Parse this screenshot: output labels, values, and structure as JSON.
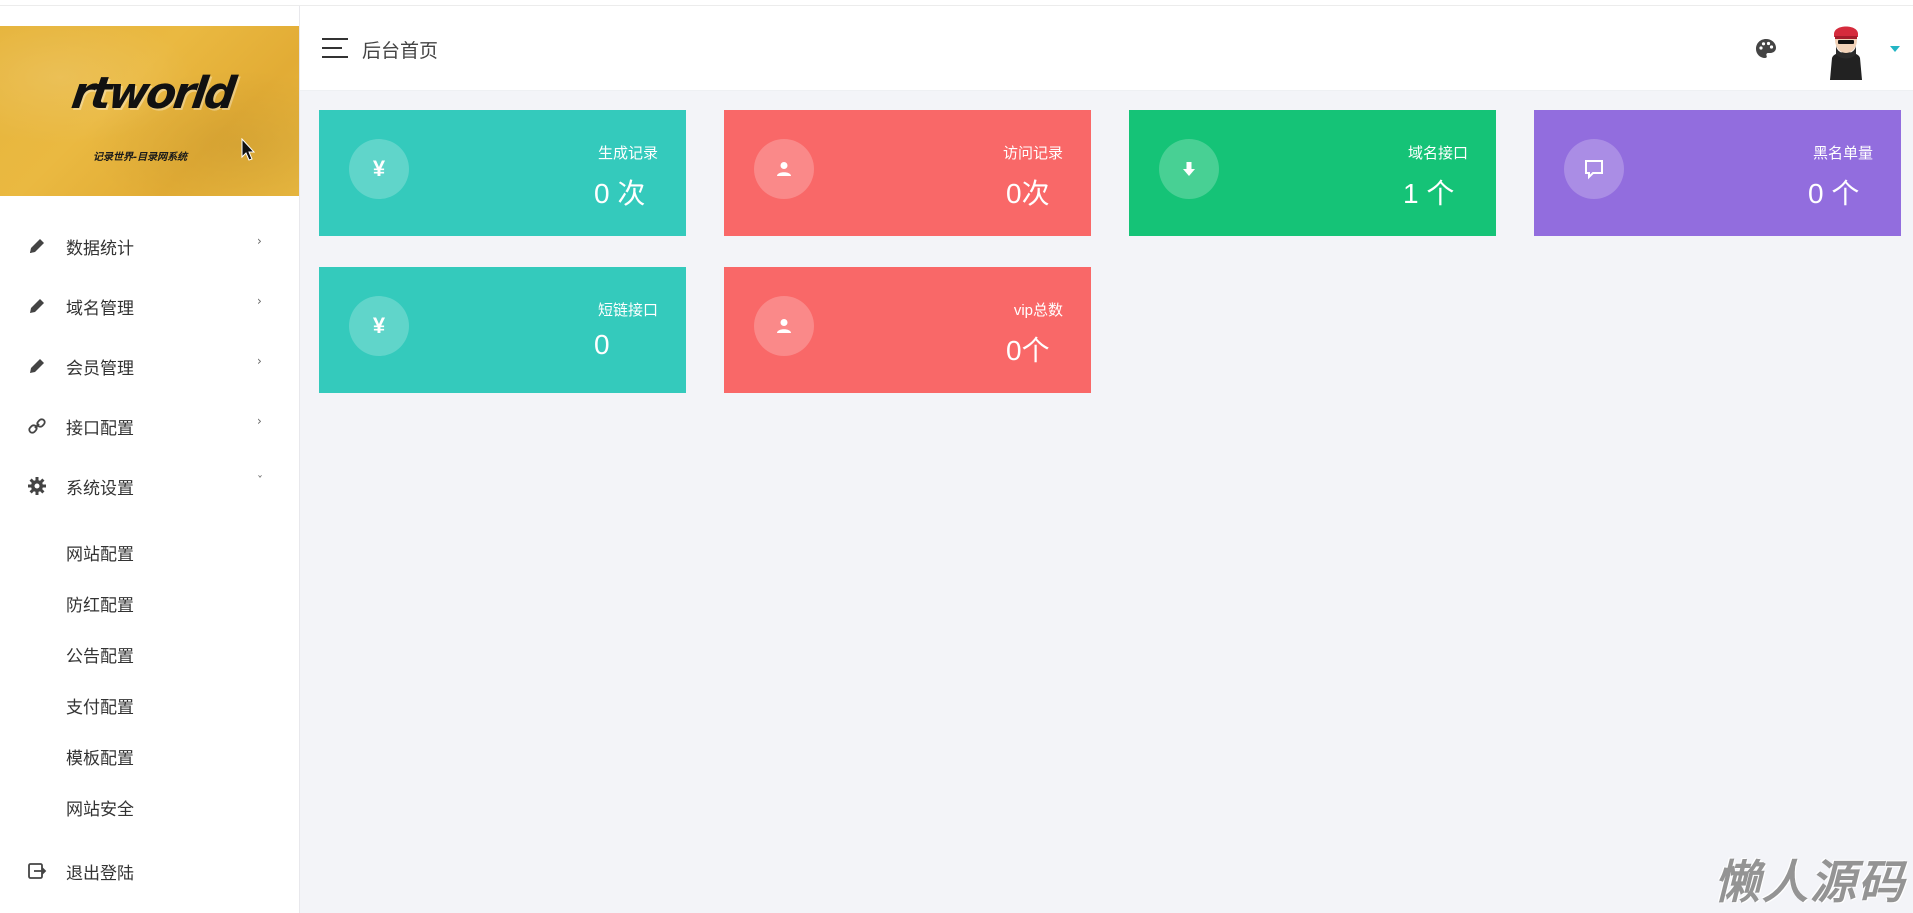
{
  "logo": {
    "wordmark": "rtworld",
    "tagline": "记录世界-目录网系统"
  },
  "header": {
    "title": "后台首页",
    "caret_color": "#23b5c4"
  },
  "sidebar": {
    "items": [
      {
        "label": "数据统计",
        "icon": "pencil-icon",
        "arrow": "›"
      },
      {
        "label": "域名管理",
        "icon": "pencil-icon",
        "arrow": "›"
      },
      {
        "label": "会员管理",
        "icon": "pencil-icon",
        "arrow": "›"
      },
      {
        "label": "接口配置",
        "icon": "link-icon",
        "arrow": "›"
      },
      {
        "label": "系统设置",
        "icon": "gear-icon",
        "arrow": "ˇ"
      }
    ],
    "sub_items": [
      "网站配置",
      "防红配置",
      "公告配置",
      "支付配置",
      "模板配置",
      "网站安全"
    ],
    "logout": {
      "label": "退出登陆",
      "icon": "logout-icon"
    }
  },
  "cards": [
    {
      "title": "生成记录",
      "value": "0 次",
      "icon": "yen-icon",
      "color": "#34cabc"
    },
    {
      "title": "访问记录",
      "value": "0次",
      "icon": "user-icon",
      "color": "#f96868"
    },
    {
      "title": "域名接口",
      "value": "1 个",
      "icon": "download-icon",
      "color": "#15c377"
    },
    {
      "title": "黑名单量",
      "value": "0 个",
      "icon": "message-icon",
      "color": "#926dde"
    },
    {
      "title": "短链接口",
      "value": "0",
      "icon": "yen-icon",
      "color": "#34cabc"
    },
    {
      "title": "vip总数",
      "value": "0个",
      "icon": "user-icon",
      "color": "#f96868"
    }
  ],
  "watermark": "懒人源码"
}
